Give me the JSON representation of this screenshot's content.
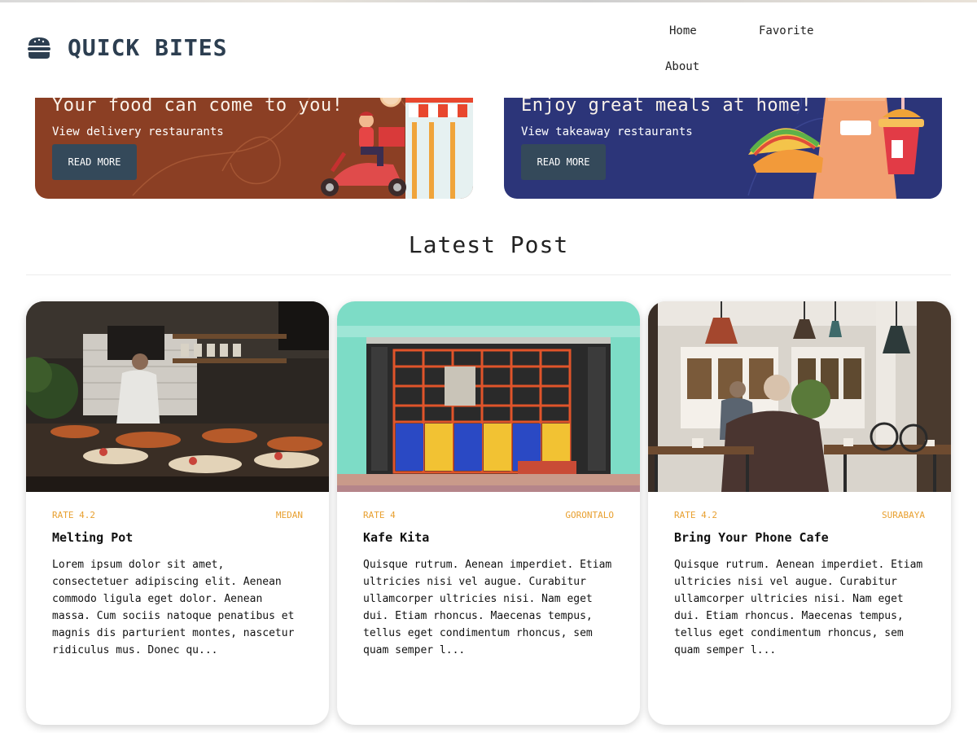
{
  "header": {
    "brand": "QUICK BITES",
    "logo_icon": "burger-icon",
    "nav": {
      "home": "Home",
      "favorite": "Favorite",
      "about": "About"
    }
  },
  "banners": [
    {
      "title": "Your food can come to you!",
      "subtitle": "View delivery restaurants",
      "button": "READ MORE",
      "sign": "restaurant",
      "color": "#8b3f24"
    },
    {
      "title": "Enjoy great meals at home!",
      "subtitle": "View takeaway restaurants",
      "button": "READ MORE",
      "color": "#2c3579"
    }
  ],
  "latest": {
    "title": "Latest Post",
    "posts": [
      {
        "rate": "RATE 4.2",
        "city": "MEDAN",
        "name": "Melting Pot",
        "description": "Lorem ipsum dolor sit amet, consectetuer adipiscing elit. Aenean commodo ligula eget dolor. Aenean massa. Cum sociis natoque penatibus et magnis dis parturient montes, nascetur ridiculus mus. Donec qu..."
      },
      {
        "rate": "RATE 4",
        "city": "GORONTALO",
        "name": "Kafe Kita",
        "description": "Quisque rutrum. Aenean imperdiet. Etiam ultricies nisi vel augue. Curabitur ullamcorper ultricies nisi. Nam eget dui. Etiam rhoncus. Maecenas tempus, tellus eget condimentum rhoncus, sem quam semper l..."
      },
      {
        "rate": "RATE 4.2",
        "city": "SURABAYA",
        "name": "Bring Your Phone Cafe",
        "description": "Quisque rutrum. Aenean imperdiet. Etiam ultricies nisi vel augue. Curabitur ullamcorper ultricies nisi. Nam eget dui. Etiam rhoncus. Maecenas tempus, tellus eget condimentum rhoncus, sem quam semper l..."
      }
    ]
  },
  "colors": {
    "accent": "#e8a030",
    "brand": "#2c3e50",
    "button": "#34495a"
  }
}
